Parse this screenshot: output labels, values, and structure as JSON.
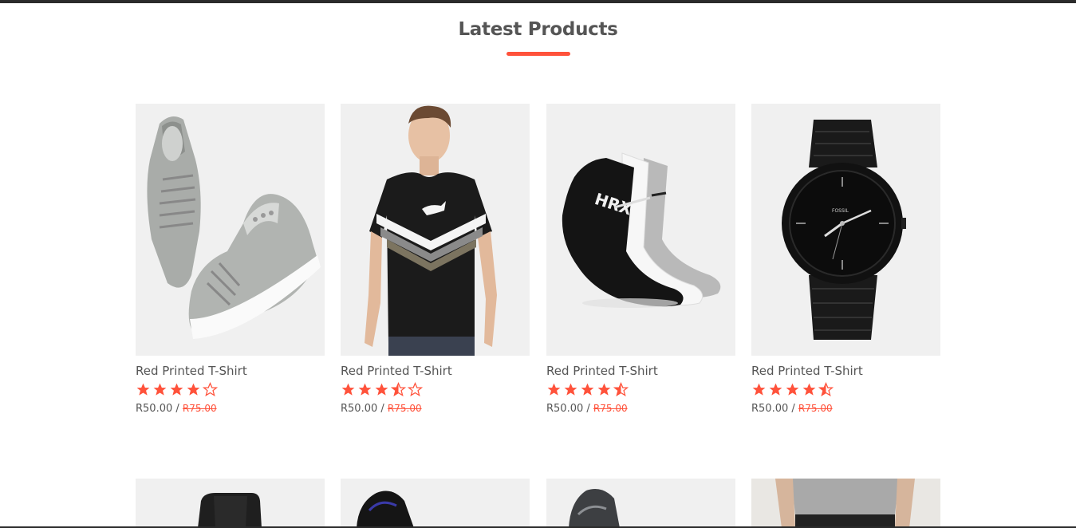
{
  "section": {
    "title": "Latest Products",
    "accent_color": "#ff523b"
  },
  "products": [
    {
      "name": "Red Printed T-Shirt",
      "rating": 4,
      "price": "R50.00",
      "separator": "/",
      "old_price": "R75.00",
      "image": "grey-sneakers"
    },
    {
      "name": "Red Printed T-Shirt",
      "rating": 3.5,
      "price": "R50.00",
      "separator": "/",
      "old_price": "R75.00",
      "image": "black-tshirt-model"
    },
    {
      "name": "Red Printed T-Shirt",
      "rating": 4.5,
      "price": "R50.00",
      "separator": "/",
      "old_price": "R75.00",
      "image": "hrx-socks"
    },
    {
      "name": "Red Printed T-Shirt",
      "rating": 4.5,
      "price": "R50.00",
      "separator": "/",
      "old_price": "R75.00",
      "image": "fossil-black-watch",
      "watch_brand": "FOSSIL"
    }
  ],
  "products_row2": [
    {
      "image": "black-shoe-top"
    },
    {
      "image": "black-sneaker-top"
    },
    {
      "image": "grey-shoe-top"
    },
    {
      "image": "grey-shirt-model"
    }
  ]
}
